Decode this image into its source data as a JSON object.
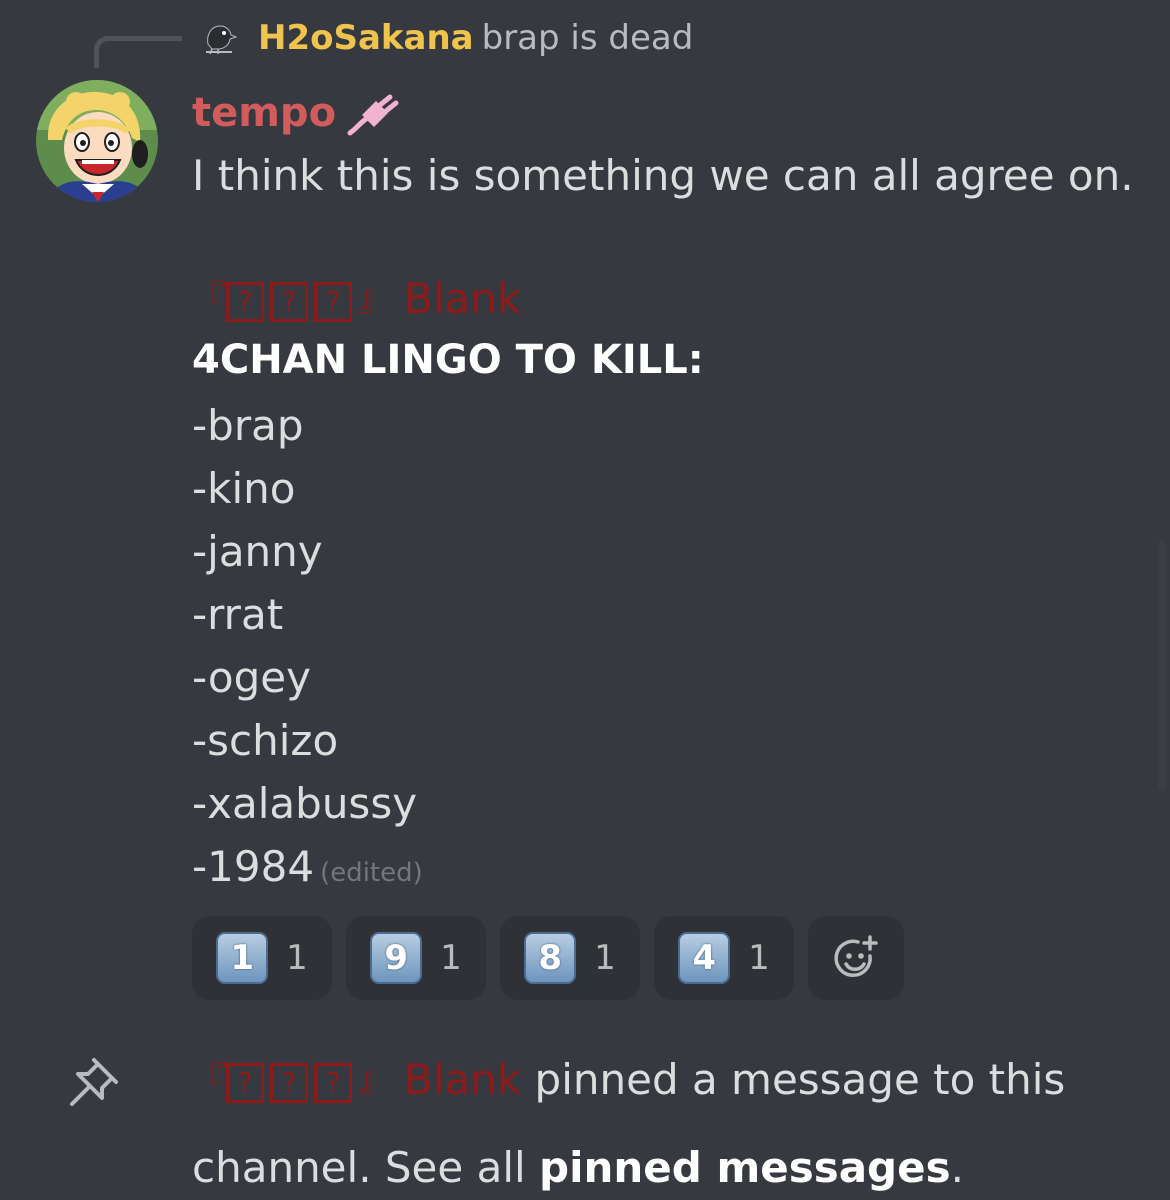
{
  "reply": {
    "author": "H2oSakana",
    "preview": "brap is dead"
  },
  "message": {
    "author": "tempo",
    "line1": "I think this is something we can all agree on.",
    "quoted_bracket_open": "『",
    "quoted_bracket_close": "』",
    "quoted_glyph": "?",
    "quoted_name": "Blank",
    "headline": "4CHAN LINGO TO KILL:",
    "items": [
      "-brap",
      "-kino",
      "-janny",
      "-rrat",
      "-ogey",
      "-schizo",
      "-xalabussy",
      "-1984"
    ],
    "edited": "(edited)"
  },
  "reactions": [
    {
      "emoji": "1",
      "count": "1"
    },
    {
      "emoji": "9",
      "count": "1"
    },
    {
      "emoji": "8",
      "count": "1"
    },
    {
      "emoji": "4",
      "count": "1"
    }
  ],
  "system": {
    "pinner_bracket_open": "『",
    "pinner_bracket_close": "』",
    "pinner_glyph": "?",
    "pinner_name": "Blank",
    "text_a": "pinned a message to this",
    "text_b": "channel. See all",
    "link": "pinned messages",
    "text_c": "."
  },
  "icons": {
    "reply_avatar": "crow-avatar-icon",
    "avatar": "anime-girl-avatar",
    "badge": "plug-icon",
    "add_reaction": "add-reaction-icon",
    "pin": "pin-icon"
  },
  "colors": {
    "background": "#36393f",
    "reply_author": "#f0c44c",
    "author": "#d25c5c",
    "role": "#8e1a1a",
    "text": "#dcddde",
    "reaction_bg": "#2f3136"
  }
}
